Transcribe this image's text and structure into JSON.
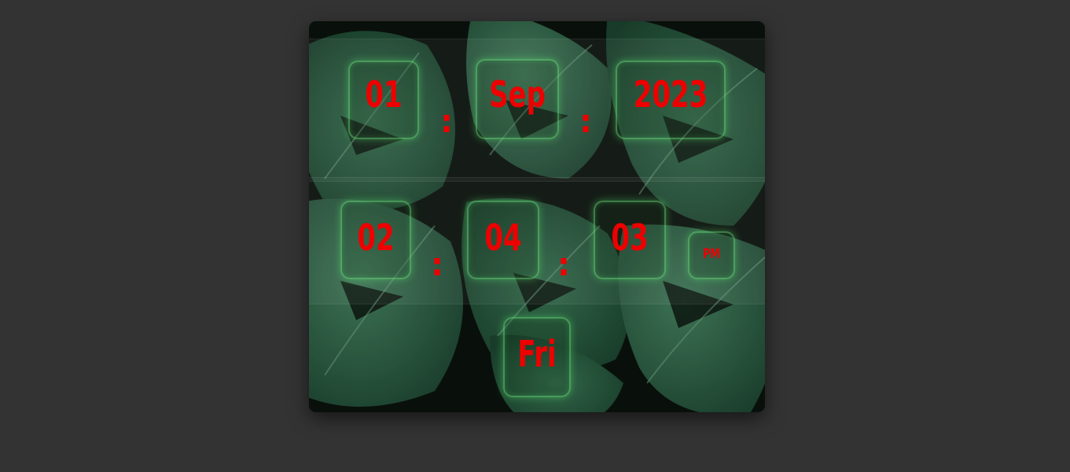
{
  "clock": {
    "date": {
      "day": "01",
      "month": "Sep",
      "year": "2023"
    },
    "time": {
      "hours": "02",
      "minutes": "04",
      "seconds": "03",
      "meridiem": "PM"
    },
    "weekday": "Fri",
    "separator": ":"
  },
  "colors": {
    "page_background": "#333333",
    "digit_color": "#ee0000",
    "glass_glow": "#78ff8c",
    "leaf_green": "#2f6a4a"
  }
}
